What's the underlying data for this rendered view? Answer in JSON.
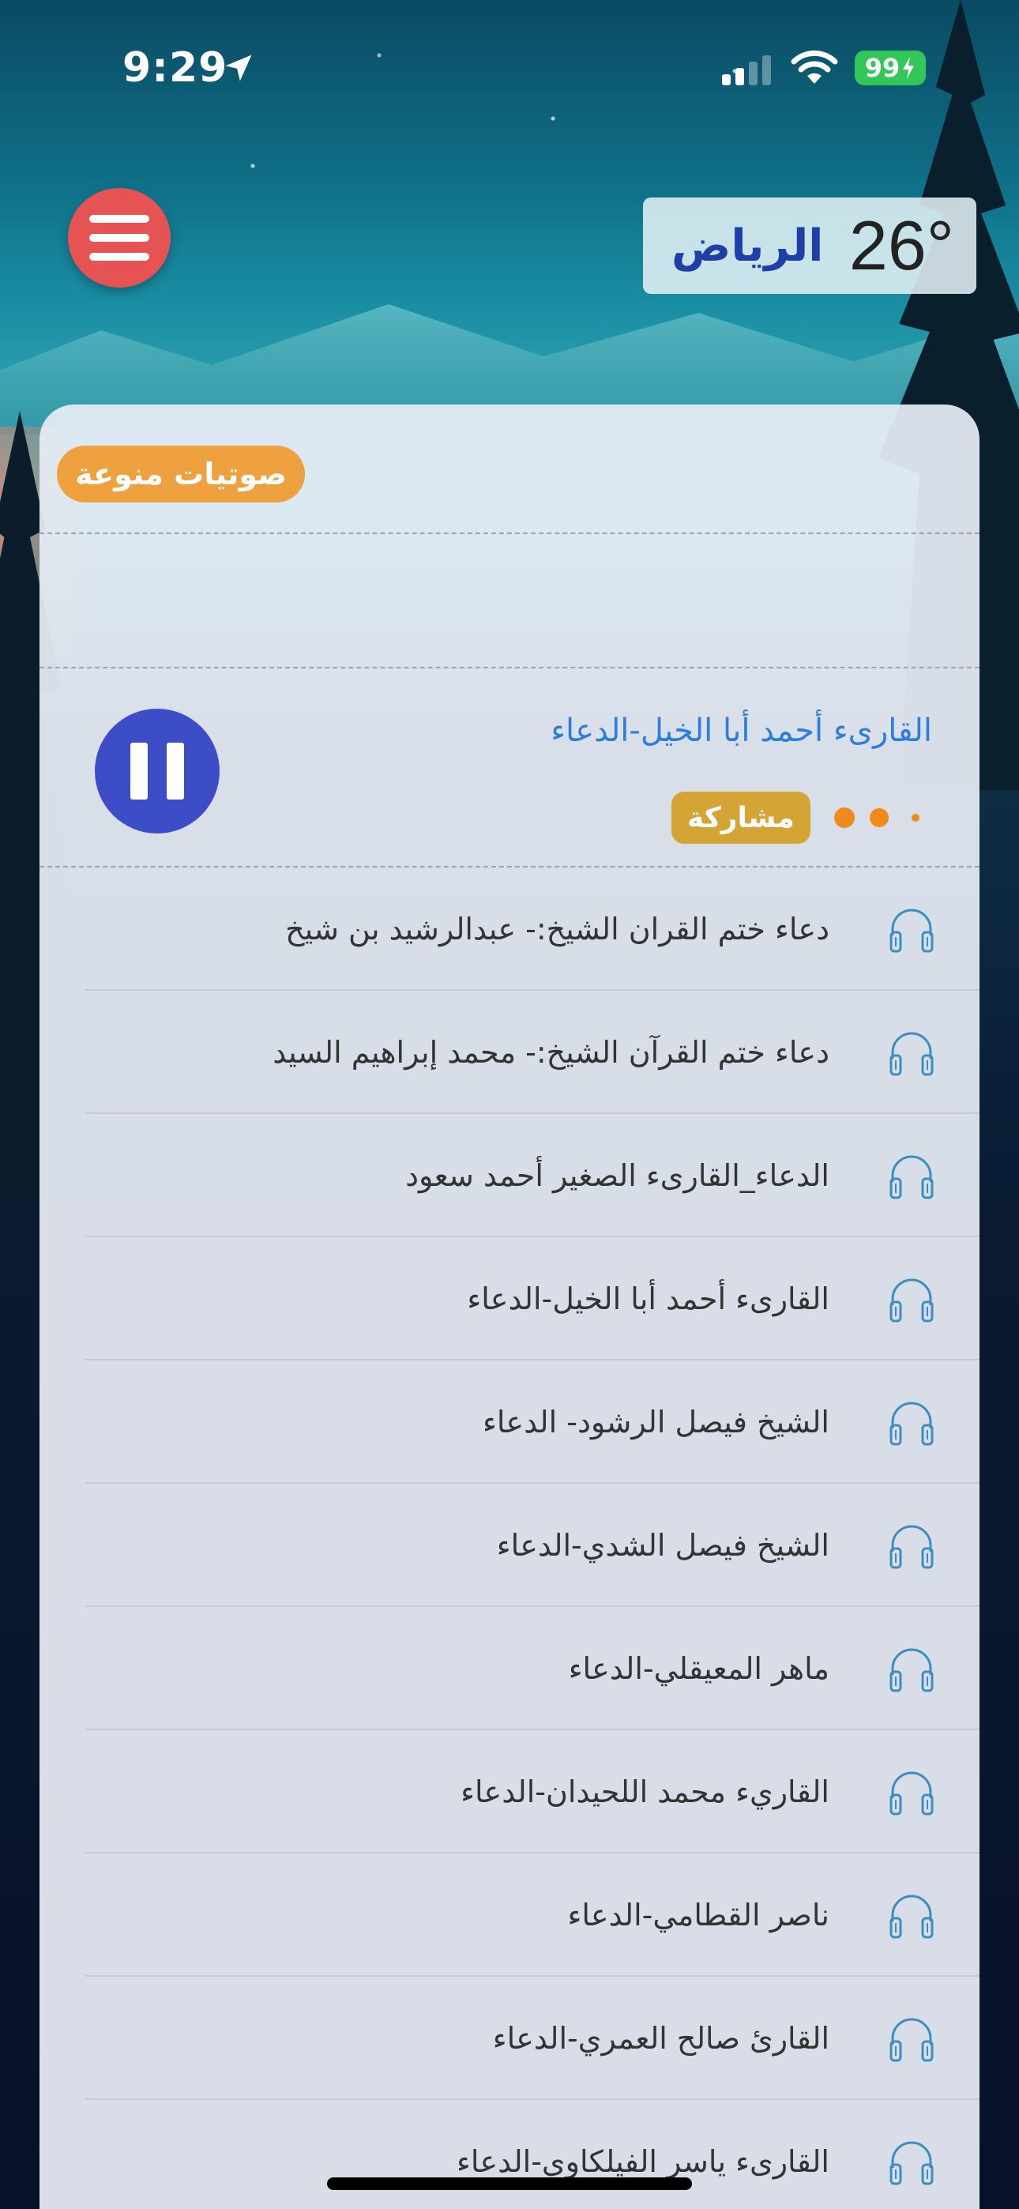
{
  "status_bar": {
    "time": "9:29",
    "battery": "99"
  },
  "weather": {
    "city": "الرياض",
    "temperature": "26°"
  },
  "category_tag": "صوتيات منوعة",
  "now_playing": {
    "title": "القارىء أحمد أبا الخيل-الدعاء",
    "share_label": "مشاركة",
    "state": "playing"
  },
  "tracks": [
    "دعاء ختم القران الشيخ:- عبدالرشيد بن شيخ",
    "دعاء ختم القرآن الشيخ:- محمد إبراهيم السيد",
    "الدعاء_القارىء الصغير أحمد سعود",
    "القارىء أحمد أبا الخيل-الدعاء",
    "الشيخ فيصل الرشود- الدعاء",
    "الشيخ فيصل الشدي-الدعاء",
    "ماهر المعيقلي-الدعاء",
    "القاريء محمد اللحيدان-الدعاء",
    "ناصر القطامي-الدعاء",
    "القارئ صالح العمري-الدعاء",
    "القارىء ياسر الفيلكاوي-الدعاء"
  ],
  "colors": {
    "menu_button": "#e55353",
    "category_tag": "#efa03f",
    "pause_button": "#3d4dc8",
    "share_button": "#d4a534",
    "now_playing_title": "#2b7de0",
    "headphone_icon": "#3a8fc0"
  },
  "icons": {
    "menu": "hamburger-icon",
    "pause": "pause-icon",
    "track": "headphones-icon",
    "location": "location-arrow-icon",
    "wifi": "wifi-icon",
    "signal": "cellular-signal-icon"
  }
}
